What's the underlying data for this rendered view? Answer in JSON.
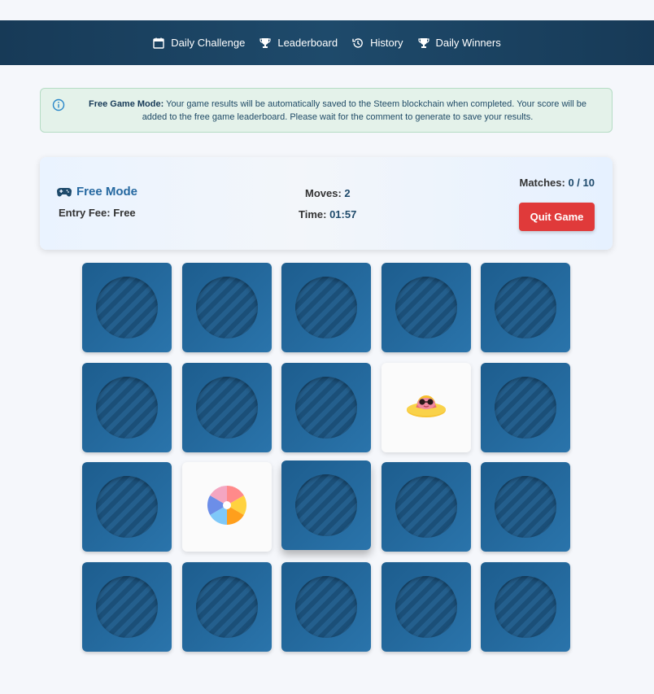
{
  "nav": {
    "items": [
      {
        "label": "Daily Challenge",
        "icon": "calendar-icon"
      },
      {
        "label": "Leaderboard",
        "icon": "trophy-icon"
      },
      {
        "label": "History",
        "icon": "history-icon"
      },
      {
        "label": "Daily Winners",
        "icon": "trophy-icon"
      }
    ]
  },
  "alert": {
    "title": "Free Game Mode:",
    "message": "Your game results will be automatically saved to the Steem blockchain when completed. Your score will be added to the free game leaderboard. Please wait for the comment to generate to save your results.",
    "icon": "info-icon"
  },
  "game": {
    "mode_label": "Free Mode",
    "mode_icon": "gamepad-icon",
    "entry_fee_label": "Entry Fee:",
    "entry_fee_value": "Free",
    "moves_label": "Moves:",
    "moves_value": "2",
    "time_label": "Time:",
    "time_value": "01:57",
    "matches_label": "Matches:",
    "matches_value": "0 / 10",
    "quit_label": "Quit Game"
  },
  "board": {
    "cards": [
      {
        "state": "down"
      },
      {
        "state": "down"
      },
      {
        "state": "down"
      },
      {
        "state": "down"
      },
      {
        "state": "down"
      },
      {
        "state": "down"
      },
      {
        "state": "down"
      },
      {
        "state": "down"
      },
      {
        "state": "up",
        "icon": "sun-hat-sunglasses-icon"
      },
      {
        "state": "down"
      },
      {
        "state": "down"
      },
      {
        "state": "up",
        "icon": "beach-ball-icon"
      },
      {
        "state": "down",
        "hover": true
      },
      {
        "state": "down"
      },
      {
        "state": "down"
      },
      {
        "state": "down"
      },
      {
        "state": "down"
      },
      {
        "state": "down"
      },
      {
        "state": "down"
      },
      {
        "state": "down"
      }
    ]
  },
  "colors": {
    "header": "#1e4a6b",
    "accent": "#2568a0",
    "danger": "#e03a3a",
    "card_back": "#2a74ab",
    "alert_bg": "#e4f2ea"
  }
}
